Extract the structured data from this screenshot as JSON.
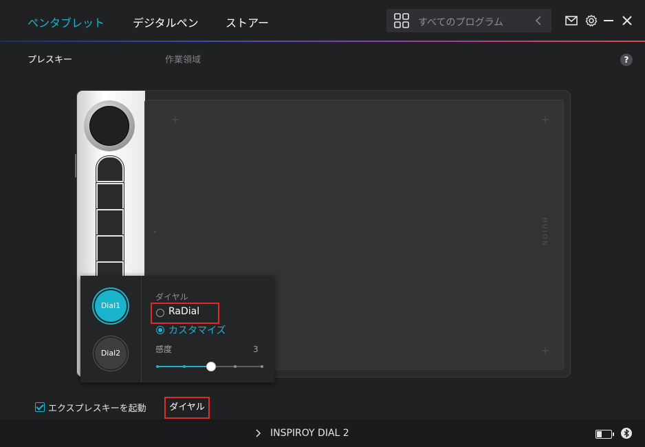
{
  "header": {
    "tabs": [
      {
        "label": "ペンタブレット",
        "active": true
      },
      {
        "label": "デジタルペン",
        "active": false
      },
      {
        "label": "ストアー",
        "active": false
      }
    ],
    "search": {
      "placeholder": "すべてのプログラム"
    },
    "icons": [
      "grid-icon",
      "chevron-left-icon",
      "mail-icon",
      "gear-icon",
      "minimize-icon",
      "close-icon"
    ]
  },
  "subtabs": [
    {
      "label": "プレスキー",
      "active": true
    },
    {
      "label": "作業領域",
      "active": false
    }
  ],
  "help": {
    "label": "?"
  },
  "tablet": {
    "brand": "HUION"
  },
  "popup": {
    "dials": [
      {
        "label": "Dial1",
        "selected": true
      },
      {
        "label": "Dial2",
        "selected": false
      }
    ],
    "title": "ダイヤル",
    "options": [
      {
        "label": "RaDial",
        "checked": false
      },
      {
        "label": "カスタマイズ",
        "checked": true
      }
    ],
    "sensitivity": {
      "label": "感度",
      "value": "3",
      "level_fraction": 0.5
    }
  },
  "bottom": {
    "checkbox_label": "エクスプレスキーを起動",
    "checkbox_checked": true,
    "dial_tag": "ダイヤル"
  },
  "footer": {
    "device": "INSPIROY DIAL 2"
  },
  "colors": {
    "accent": "#1fb2cf",
    "highlight": "#e12a2a",
    "background": "#202122"
  }
}
